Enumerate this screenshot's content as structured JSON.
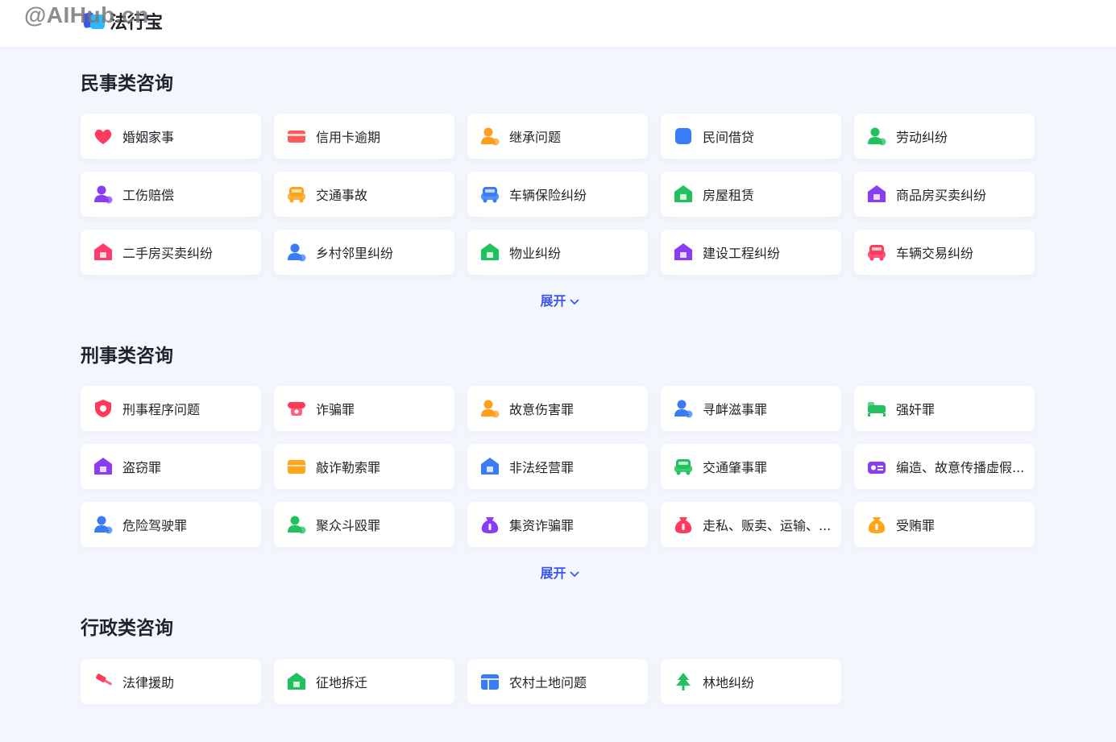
{
  "header": {
    "watermark": "@AIHub.cn",
    "brand": "法行宝",
    "logo_icon": "logo-mark-icon"
  },
  "colors": {
    "accent": "#3d55e8",
    "background": "#f4f6fd",
    "card": "#ffffff"
  },
  "sections": [
    {
      "title": "民事类咨询",
      "expand_label": "展开",
      "items": [
        {
          "label": "婚姻家事",
          "icon": "heart-icon",
          "color": "#ff3b5c"
        },
        {
          "label": "信用卡逾期",
          "icon": "credit-card-icon",
          "color": "#ff5a5a"
        },
        {
          "label": "继承问题",
          "icon": "person-lock-icon",
          "color": "#ff9d1c"
        },
        {
          "label": "民间借贷",
          "icon": "loan-card-icon",
          "color": "#3a7cf5"
        },
        {
          "label": "劳动纠纷",
          "icon": "worker-doc-icon",
          "color": "#21c25d"
        },
        {
          "label": "工伤赔偿",
          "icon": "person-plus-icon",
          "color": "#8a3cf0"
        },
        {
          "label": "交通事故",
          "icon": "car-front-icon",
          "color": "#ffa51c"
        },
        {
          "label": "车辆保险纠纷",
          "icon": "car-insurance-icon",
          "color": "#3a7cf5"
        },
        {
          "label": "房屋租赁",
          "icon": "house-rent-icon",
          "color": "#21c25d"
        },
        {
          "label": "商品房买卖纠纷",
          "icon": "house-yen-icon",
          "color": "#8a3cf0"
        },
        {
          "label": "二手房买卖纠纷",
          "icon": "house-cycle-icon",
          "color": "#ff3b6b"
        },
        {
          "label": "乡村邻里纠纷",
          "icon": "person-pin-icon",
          "color": "#3a7cf5"
        },
        {
          "label": "物业纠纷",
          "icon": "house-key-icon",
          "color": "#21c25d"
        },
        {
          "label": "建设工程纠纷",
          "icon": "building-doc-icon",
          "color": "#8a3cf0"
        },
        {
          "label": "车辆交易纠纷",
          "icon": "car-trade-icon",
          "color": "#ff3b5c"
        }
      ]
    },
    {
      "title": "刑事类咨询",
      "expand_label": "展开",
      "items": [
        {
          "label": "刑事程序问题",
          "icon": "shield-badge-icon",
          "color": "#ff3b5c"
        },
        {
          "label": "诈骗罪",
          "icon": "telephone-icon",
          "color": "#ff3b5c"
        },
        {
          "label": "故意伤害罪",
          "icon": "person-hurt-icon",
          "color": "#ff9d1c"
        },
        {
          "label": "寻衅滋事罪",
          "icon": "person-alert-icon",
          "color": "#3a7cf5"
        },
        {
          "label": "强奸罪",
          "icon": "bed-icon",
          "color": "#21c25d"
        },
        {
          "label": "盗窃罪",
          "icon": "house-alert-icon",
          "color": "#8a3cf0"
        },
        {
          "label": "敲诈勒索罪",
          "icon": "wallet-icon",
          "color": "#ffa51c"
        },
        {
          "label": "非法经营罪",
          "icon": "shop-yen-icon",
          "color": "#3a7cf5"
        },
        {
          "label": "交通肇事罪",
          "icon": "truck-alert-icon",
          "color": "#21c25d"
        },
        {
          "label": "编造、故意传播虚假...",
          "icon": "radio-icon",
          "color": "#8a3cf0"
        },
        {
          "label": "危险驾驶罪",
          "icon": "person-drive-icon",
          "color": "#3a7cf5"
        },
        {
          "label": "聚众斗殴罪",
          "icon": "group-fight-icon",
          "color": "#21c25d"
        },
        {
          "label": "集资诈骗罪",
          "icon": "money-bag-icon",
          "color": "#8a3cf0"
        },
        {
          "label": "走私、贩卖、运输、...",
          "icon": "bag-alert-icon",
          "color": "#ff3b5c"
        },
        {
          "label": "受贿罪",
          "icon": "yen-down-icon",
          "color": "#ffa51c"
        }
      ]
    },
    {
      "title": "行政类咨询",
      "items": [
        {
          "label": "法律援助",
          "icon": "gavel-icon",
          "color": "#ff3b5c"
        },
        {
          "label": "征地拆迁",
          "icon": "house-demolish-icon",
          "color": "#21c25d"
        },
        {
          "label": "农村土地问题",
          "icon": "land-grid-icon",
          "color": "#3a7cf5"
        },
        {
          "label": "林地纠纷",
          "icon": "tree-icon",
          "color": "#21c25d"
        }
      ]
    }
  ]
}
